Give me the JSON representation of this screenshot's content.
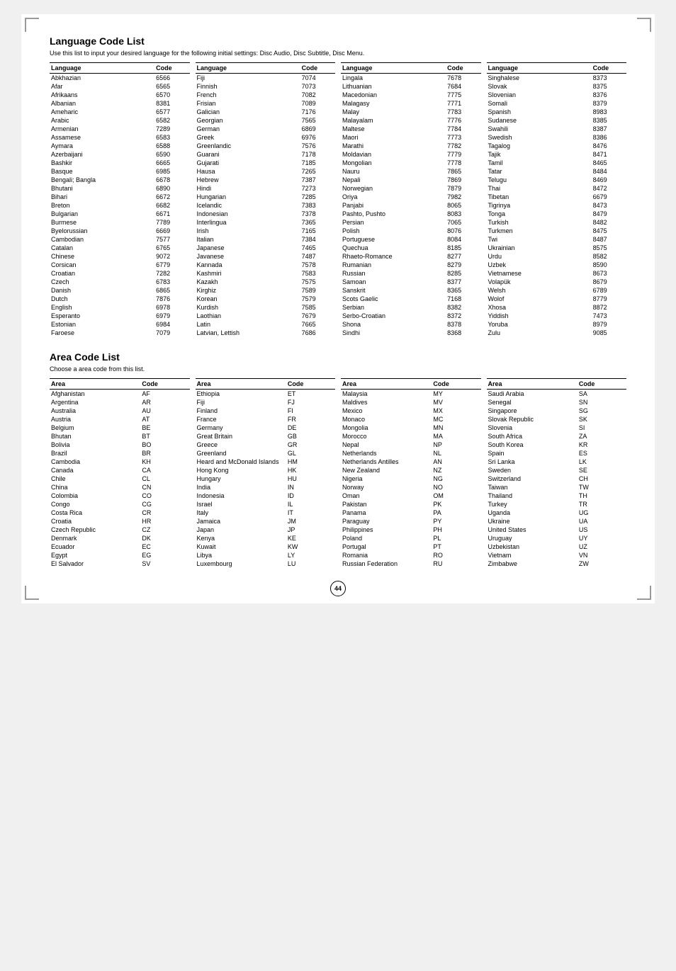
{
  "page": {
    "title_lang": "Language Code List",
    "subtitle_lang": "Use this list to input your desired language for the following initial settings: Disc Audio, Disc Subtitle, Disc Menu.",
    "title_area": "Area Code List",
    "subtitle_area": "Choose a area code from this list.",
    "page_number": "44"
  },
  "lang_col1_header": [
    "Language",
    "Code"
  ],
  "lang_col1": [
    [
      "Abkhazian",
      "6566"
    ],
    [
      "Afar",
      "6565"
    ],
    [
      "Afrikaans",
      "6570"
    ],
    [
      "Albanian",
      "8381"
    ],
    [
      "Ameharic",
      "6577"
    ],
    [
      "Arabic",
      "6582"
    ],
    [
      "Armenian",
      "7289"
    ],
    [
      "Assamese",
      "6583"
    ],
    [
      "Aymara",
      "6588"
    ],
    [
      "Azerbaijani",
      "6590"
    ],
    [
      "Bashkir",
      "6665"
    ],
    [
      "Basque",
      "6985"
    ],
    [
      "Bengali; Bangla",
      "6678"
    ],
    [
      "Bhutani",
      "6890"
    ],
    [
      "Bihari",
      "6672"
    ],
    [
      "Breton",
      "6682"
    ],
    [
      "Bulgarian",
      "6671"
    ],
    [
      "Burmese",
      "7789"
    ],
    [
      "Byelorussian",
      "6669"
    ],
    [
      "Cambodian",
      "7577"
    ],
    [
      "Catalan",
      "6765"
    ],
    [
      "Chinese",
      "9072"
    ],
    [
      "Corsican",
      "6779"
    ],
    [
      "Croatian",
      "7282"
    ],
    [
      "Czech",
      "6783"
    ],
    [
      "Danish",
      "6865"
    ],
    [
      "Dutch",
      "7876"
    ],
    [
      "English",
      "6978"
    ],
    [
      "Esperanto",
      "6979"
    ],
    [
      "Estonian",
      "6984"
    ],
    [
      "Faroese",
      "7079"
    ]
  ],
  "lang_col2_header": [
    "Language",
    "Code"
  ],
  "lang_col2": [
    [
      "Fiji",
      "7074"
    ],
    [
      "Finnish",
      "7073"
    ],
    [
      "French",
      "7082"
    ],
    [
      "Frisian",
      "7089"
    ],
    [
      "Galician",
      "7176"
    ],
    [
      "Georgian",
      "7565"
    ],
    [
      "German",
      "6869"
    ],
    [
      "Greek",
      "6976"
    ],
    [
      "Greenlandic",
      "7576"
    ],
    [
      "Guarani",
      "7178"
    ],
    [
      "Gujarati",
      "7185"
    ],
    [
      "Hausa",
      "7265"
    ],
    [
      "Hebrew",
      "7387"
    ],
    [
      "Hindi",
      "7273"
    ],
    [
      "Hungarian",
      "7285"
    ],
    [
      "Icelandic",
      "7383"
    ],
    [
      "Indonesian",
      "7378"
    ],
    [
      "Interlingua",
      "7365"
    ],
    [
      "Irish",
      "7165"
    ],
    [
      "Italian",
      "7384"
    ],
    [
      "Japanese",
      "7465"
    ],
    [
      "Javanese",
      "7487"
    ],
    [
      "Kannada",
      "7578"
    ],
    [
      "Kashmiri",
      "7583"
    ],
    [
      "Kazakh",
      "7575"
    ],
    [
      "Kirghiz",
      "7589"
    ],
    [
      "Korean",
      "7579"
    ],
    [
      "Kurdish",
      "7585"
    ],
    [
      "Laothian",
      "7679"
    ],
    [
      "Latin",
      "7665"
    ],
    [
      "Latvian, Lettish",
      "7686"
    ]
  ],
  "lang_col3_header": [
    "Language",
    "Code"
  ],
  "lang_col3": [
    [
      "Lingala",
      "7678"
    ],
    [
      "Lithuanian",
      "7684"
    ],
    [
      "Macedonian",
      "7775"
    ],
    [
      "Malagasy",
      "7771"
    ],
    [
      "Malay",
      "7783"
    ],
    [
      "Malayalam",
      "7776"
    ],
    [
      "Maltese",
      "7784"
    ],
    [
      "Maori",
      "7773"
    ],
    [
      "Marathi",
      "7782"
    ],
    [
      "Moldavian",
      "7779"
    ],
    [
      "Mongolian",
      "7778"
    ],
    [
      "Nauru",
      "7865"
    ],
    [
      "Nepali",
      "7869"
    ],
    [
      "Norwegian",
      "7879"
    ],
    [
      "Oriya",
      "7982"
    ],
    [
      "Panjabi",
      "8065"
    ],
    [
      "Pashto, Pushto",
      "8083"
    ],
    [
      "Persian",
      "7065"
    ],
    [
      "Polish",
      "8076"
    ],
    [
      "Portuguese",
      "8084"
    ],
    [
      "Quechua",
      "8185"
    ],
    [
      "Rhaeto-Romance",
      "8277"
    ],
    [
      "Rumanian",
      "8279"
    ],
    [
      "Russian",
      "8285"
    ],
    [
      "Samoan",
      "8377"
    ],
    [
      "Sanskrit",
      "8365"
    ],
    [
      "Scots Gaelic",
      "7168"
    ],
    [
      "Serbian",
      "8382"
    ],
    [
      "Serbo-Croatian",
      "8372"
    ],
    [
      "Shona",
      "8378"
    ],
    [
      "Sindhi",
      "8368"
    ]
  ],
  "lang_col4_header": [
    "Language",
    "Code"
  ],
  "lang_col4": [
    [
      "Singhalese",
      "8373"
    ],
    [
      "Slovak",
      "8375"
    ],
    [
      "Slovenian",
      "8376"
    ],
    [
      "Somali",
      "8379"
    ],
    [
      "Spanish",
      "8983"
    ],
    [
      "Sudanese",
      "8385"
    ],
    [
      "Swahili",
      "8387"
    ],
    [
      "Swedish",
      "8386"
    ],
    [
      "Tagalog",
      "8476"
    ],
    [
      "Tajik",
      "8471"
    ],
    [
      "Tamil",
      "8465"
    ],
    [
      "Tatar",
      "8484"
    ],
    [
      "Telugu",
      "8469"
    ],
    [
      "Thai",
      "8472"
    ],
    [
      "Tibetan",
      "6679"
    ],
    [
      "Tigrinya",
      "8473"
    ],
    [
      "Tonga",
      "8479"
    ],
    [
      "Turkish",
      "8482"
    ],
    [
      "Turkmen",
      "8475"
    ],
    [
      "Twi",
      "8487"
    ],
    [
      "Ukrainian",
      "8575"
    ],
    [
      "Urdu",
      "8582"
    ],
    [
      "Uzbek",
      "8590"
    ],
    [
      "Vietnamese",
      "8673"
    ],
    [
      "Volapük",
      "8679"
    ],
    [
      "Welsh",
      "6789"
    ],
    [
      "Wolof",
      "8779"
    ],
    [
      "Xhosa",
      "8872"
    ],
    [
      "Yiddish",
      "7473"
    ],
    [
      "Yoruba",
      "8979"
    ],
    [
      "Zulu",
      "9085"
    ]
  ],
  "area_col1_header": [
    "Area",
    "Code"
  ],
  "area_col1": [
    [
      "Afghanistan",
      "AF"
    ],
    [
      "Argentina",
      "AR"
    ],
    [
      "Australia",
      "AU"
    ],
    [
      "Austria",
      "AT"
    ],
    [
      "Belgium",
      "BE"
    ],
    [
      "Bhutan",
      "BT"
    ],
    [
      "Bolivia",
      "BO"
    ],
    [
      "Brazil",
      "BR"
    ],
    [
      "Cambodia",
      "KH"
    ],
    [
      "Canada",
      "CA"
    ],
    [
      "Chile",
      "CL"
    ],
    [
      "China",
      "CN"
    ],
    [
      "Colombia",
      "CO"
    ],
    [
      "Congo",
      "CG"
    ],
    [
      "Costa Rica",
      "CR"
    ],
    [
      "Croatia",
      "HR"
    ],
    [
      "Czech Republic",
      "CZ"
    ],
    [
      "Denmark",
      "DK"
    ],
    [
      "Ecuador",
      "EC"
    ],
    [
      "Egypt",
      "EG"
    ],
    [
      "El Salvador",
      "SV"
    ]
  ],
  "area_col2_header": [
    "Area",
    "Code"
  ],
  "area_col2": [
    [
      "Ethiopia",
      "ET"
    ],
    [
      "Fiji",
      "FJ"
    ],
    [
      "Finland",
      "FI"
    ],
    [
      "France",
      "FR"
    ],
    [
      "Germany",
      "DE"
    ],
    [
      "Great Britain",
      "GB"
    ],
    [
      "Greece",
      "GR"
    ],
    [
      "Greenland",
      "GL"
    ],
    [
      "Heard and McDonald Islands",
      "HM"
    ],
    [
      "Hong Kong",
      "HK"
    ],
    [
      "Hungary",
      "HU"
    ],
    [
      "India",
      "IN"
    ],
    [
      "Indonesia",
      "ID"
    ],
    [
      "Israel",
      "IL"
    ],
    [
      "Italy",
      "IT"
    ],
    [
      "Jamaica",
      "JM"
    ],
    [
      "Japan",
      "JP"
    ],
    [
      "Kenya",
      "KE"
    ],
    [
      "Kuwait",
      "KW"
    ],
    [
      "Libya",
      "LY"
    ],
    [
      "Luxembourg",
      "LU"
    ]
  ],
  "area_col3_header": [
    "Area",
    "Code"
  ],
  "area_col3": [
    [
      "Malaysia",
      "MY"
    ],
    [
      "Maldives",
      "MV"
    ],
    [
      "Mexico",
      "MX"
    ],
    [
      "Monaco",
      "MC"
    ],
    [
      "Mongolia",
      "MN"
    ],
    [
      "Morocco",
      "MA"
    ],
    [
      "Nepal",
      "NP"
    ],
    [
      "Netherlands",
      "NL"
    ],
    [
      "Netherlands Antilles",
      "AN"
    ],
    [
      "New Zealand",
      "NZ"
    ],
    [
      "Nigeria",
      "NG"
    ],
    [
      "Norway",
      "NO"
    ],
    [
      "Oman",
      "OM"
    ],
    [
      "Pakistan",
      "PK"
    ],
    [
      "Panama",
      "PA"
    ],
    [
      "Paraguay",
      "PY"
    ],
    [
      "Philippines",
      "PH"
    ],
    [
      "Poland",
      "PL"
    ],
    [
      "Portugal",
      "PT"
    ],
    [
      "Romania",
      "RO"
    ],
    [
      "Russian Federation",
      "RU"
    ]
  ],
  "area_col4_header": [
    "Area",
    "Code"
  ],
  "area_col4": [
    [
      "Saudi Arabia",
      "SA"
    ],
    [
      "Senegal",
      "SN"
    ],
    [
      "Singapore",
      "SG"
    ],
    [
      "Slovak Republic",
      "SK"
    ],
    [
      "Slovenia",
      "SI"
    ],
    [
      "South Africa",
      "ZA"
    ],
    [
      "South Korea",
      "KR"
    ],
    [
      "Spain",
      "ES"
    ],
    [
      "Sri Lanka",
      "LK"
    ],
    [
      "Sweden",
      "SE"
    ],
    [
      "Switzerland",
      "CH"
    ],
    [
      "Taiwan",
      "TW"
    ],
    [
      "Thailand",
      "TH"
    ],
    [
      "Turkey",
      "TR"
    ],
    [
      "Uganda",
      "UG"
    ],
    [
      "Ukraine",
      "UA"
    ],
    [
      "United States",
      "US"
    ],
    [
      "Uruguay",
      "UY"
    ],
    [
      "Uzbekistan",
      "UZ"
    ],
    [
      "Vietnam",
      "VN"
    ],
    [
      "Zimbabwe",
      "ZW"
    ]
  ]
}
